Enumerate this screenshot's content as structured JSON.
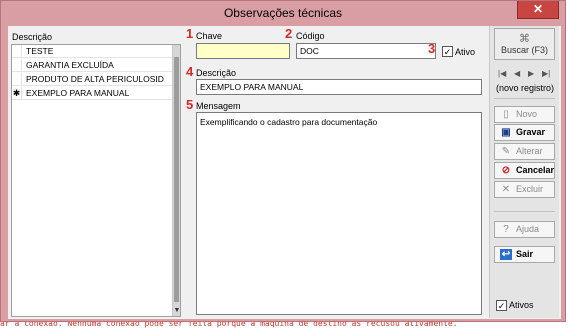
{
  "window": {
    "title": "Observações técnicas",
    "close_glyph": "✕"
  },
  "background_log": "ar a conexão. Nenhuma conexão pode ser feita porque a máquina de destino as recusou ativamente.",
  "list": {
    "header": "Descrição",
    "rows": [
      {
        "marker": "",
        "label": "TESTE"
      },
      {
        "marker": "",
        "label": "GARANTIA EXCLUÍDA"
      },
      {
        "marker": "",
        "label": "PRODUTO DE ALTA PERICULOSID"
      },
      {
        "marker": "✱",
        "label": "EXEMPLO PARA MANUAL"
      }
    ]
  },
  "form": {
    "chave": {
      "number": "1",
      "label": "Chave",
      "value": ""
    },
    "codigo": {
      "number": "2",
      "label": "Código",
      "value": "DOC"
    },
    "ativo": {
      "number": "3",
      "label": "Ativo",
      "checked": true,
      "check_glyph": "✓"
    },
    "descricao": {
      "number": "4",
      "label": "Descrição",
      "value": "EXEMPLO PARA MANUAL"
    },
    "mensagem": {
      "number": "5",
      "label": "Mensagem",
      "value": "Exemplificando o cadastro para documentação"
    },
    "accent_color": "#d12b2b"
  },
  "toolbar": {
    "search": {
      "label": "Buscar (F3)",
      "icon": "binoculars-icon"
    },
    "nav": {
      "first": "|◀",
      "prev": "◀",
      "next": "▶",
      "last": "▶|"
    },
    "record_status": "(novo registro)",
    "buttons": {
      "novo": {
        "label": "Novo",
        "icon": "new-document-icon",
        "glyph": "▯"
      },
      "gravar": {
        "label": "Gravar",
        "icon": "floppy-disk-icon",
        "glyph": "▣"
      },
      "alterar": {
        "label": "Alterar",
        "icon": "pencil-icon",
        "glyph": "✎"
      },
      "cancelar": {
        "label": "Cancelar",
        "icon": "cancel-icon",
        "glyph": "⊘"
      },
      "excluir": {
        "label": "Excluir",
        "icon": "delete-x-icon",
        "glyph": "✕"
      },
      "ajuda": {
        "label": "Ajuda",
        "icon": "help-icon",
        "glyph": "?"
      },
      "sair": {
        "label": "Sair",
        "icon": "exit-icon",
        "glyph": "↩"
      }
    },
    "ativos": {
      "label": "Ativos",
      "checked": true,
      "check_glyph": "✓"
    }
  }
}
